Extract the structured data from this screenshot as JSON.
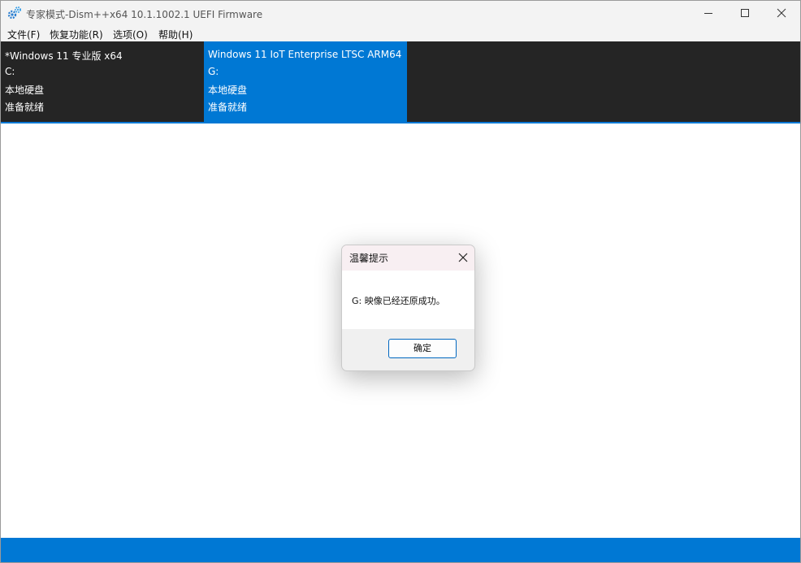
{
  "window": {
    "title": "专家模式-Dism++x64 10.1.1002.1 UEFI Firmware",
    "app_icon": "gears-icon"
  },
  "menu": {
    "items": [
      {
        "label": "文件(F)"
      },
      {
        "label": "恢复功能(R)"
      },
      {
        "label": "选项(O)"
      },
      {
        "label": "帮助(H)"
      }
    ]
  },
  "images": [
    {
      "name": "*Windows 11 专业版 x64",
      "drive": "C:",
      "type": "本地硬盘",
      "status": "准备就绪",
      "selected": false
    },
    {
      "name": "Windows 11 IoT Enterprise LTSC ARM64",
      "drive": "G:",
      "type": "本地硬盘",
      "status": "准备就绪",
      "selected": true
    }
  ],
  "dialog": {
    "title": "温馨提示",
    "message": "G: 映像已经还原成功。",
    "ok_label": "确定"
  },
  "colors": {
    "accent": "#0078d4",
    "panel_dark": "#252525",
    "titlebar": "#f3f3f3"
  }
}
